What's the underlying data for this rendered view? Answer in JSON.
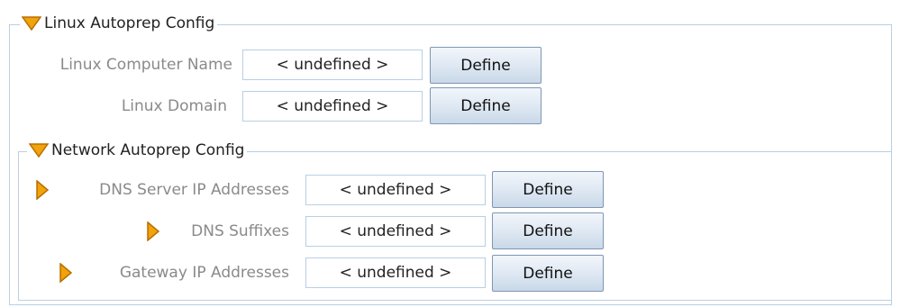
{
  "linux_section": {
    "title": "Linux Autoprep Config",
    "rows": [
      {
        "label": "Linux Computer Name",
        "value": "< undefined >",
        "button": "Define"
      },
      {
        "label": "Linux Domain",
        "value": "< undefined >",
        "button": "Define"
      }
    ]
  },
  "network_section": {
    "title": "Network Autoprep Config",
    "rows": [
      {
        "label": "DNS Server IP Addresses",
        "value": "< undefined >",
        "button": "Define"
      },
      {
        "label": "DNS Suffixes",
        "value": "< undefined >",
        "button": "Define"
      },
      {
        "label": "Gateway IP Addresses",
        "value": "< undefined >",
        "button": "Define"
      }
    ]
  },
  "colors": {
    "border": "#b8cfe5",
    "triangle_fill": "#f0a30a",
    "triangle_stroke": "#b86e00",
    "label_text": "#8a8a8a"
  },
  "icons": {
    "expanded": "triangle-down-icon",
    "collapsed": "triangle-right-icon"
  }
}
